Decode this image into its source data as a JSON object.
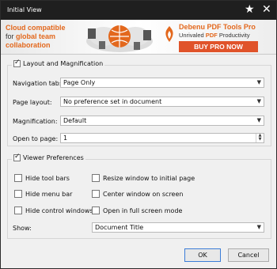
{
  "window": {
    "title": "Initial View"
  },
  "banner": {
    "left_line1": "Cloud compatible",
    "left_line2_prefix": "for ",
    "left_line2_bold": "global team",
    "left_line3": "collaboration",
    "brand": "Debenu PDF Tools Pro",
    "tagline_prefix": "Unrivaled ",
    "tagline_bold": "PDF",
    "tagline_suffix": " Productivity",
    "buy_button": "BUY PRO NOW"
  },
  "layout_group": {
    "legend": "Layout and Magnification",
    "checked": true,
    "navigation_tab": {
      "label": "Navigation tab:",
      "value": "Page Only"
    },
    "page_layout": {
      "label": "Page layout:",
      "value": "No preference set in document"
    },
    "magnification": {
      "label": "Magnification:",
      "value": "Default"
    },
    "open_to_page": {
      "label": "Open to page:",
      "value": "1"
    }
  },
  "viewer_group": {
    "legend": "Viewer Preferences",
    "checked": true,
    "options": {
      "hide_toolbars": "Hide tool bars",
      "hide_menubar": "Hide menu bar",
      "hide_controls": "Hide control windows",
      "resize_window": "Resize window to initial page",
      "center_window": "Center window on screen",
      "fullscreen": "Open in full screen mode"
    },
    "show": {
      "label": "Show:",
      "value": "Document Title"
    }
  },
  "buttons": {
    "ok": "OK",
    "cancel": "Cancel"
  }
}
